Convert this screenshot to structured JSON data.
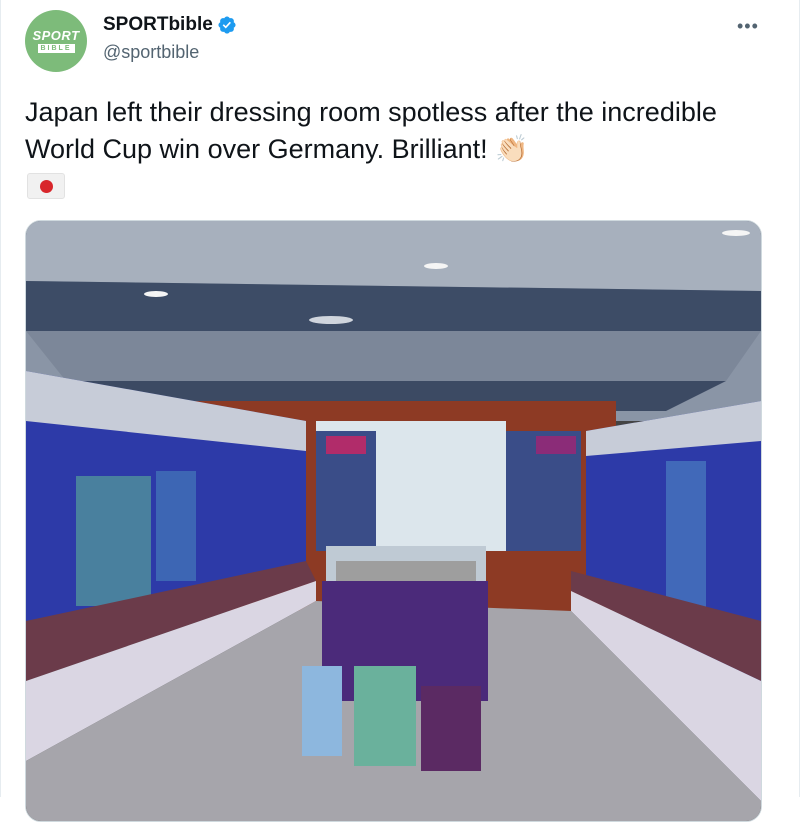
{
  "account": {
    "display_name": "SPORTbible",
    "handle": "@sportbible",
    "avatar_text_top": "SPORT",
    "avatar_text_bottom": "BIBLE",
    "verified": true
  },
  "tweet": {
    "text": "Japan left their dressing room spotless after the incredible World Cup win over Germany. Brilliant! 👏🏻",
    "flag_icon": "japan-flag-icon"
  },
  "menu": {
    "more_label": "•••"
  },
  "colors": {
    "avatar_bg": "#7dbb7a",
    "verified_blue": "#1d9bf0",
    "text_primary": "#0f1419",
    "text_secondary": "#536471",
    "locker_purple": "#4b2a7a",
    "locker_blue": "#3a45c9"
  }
}
